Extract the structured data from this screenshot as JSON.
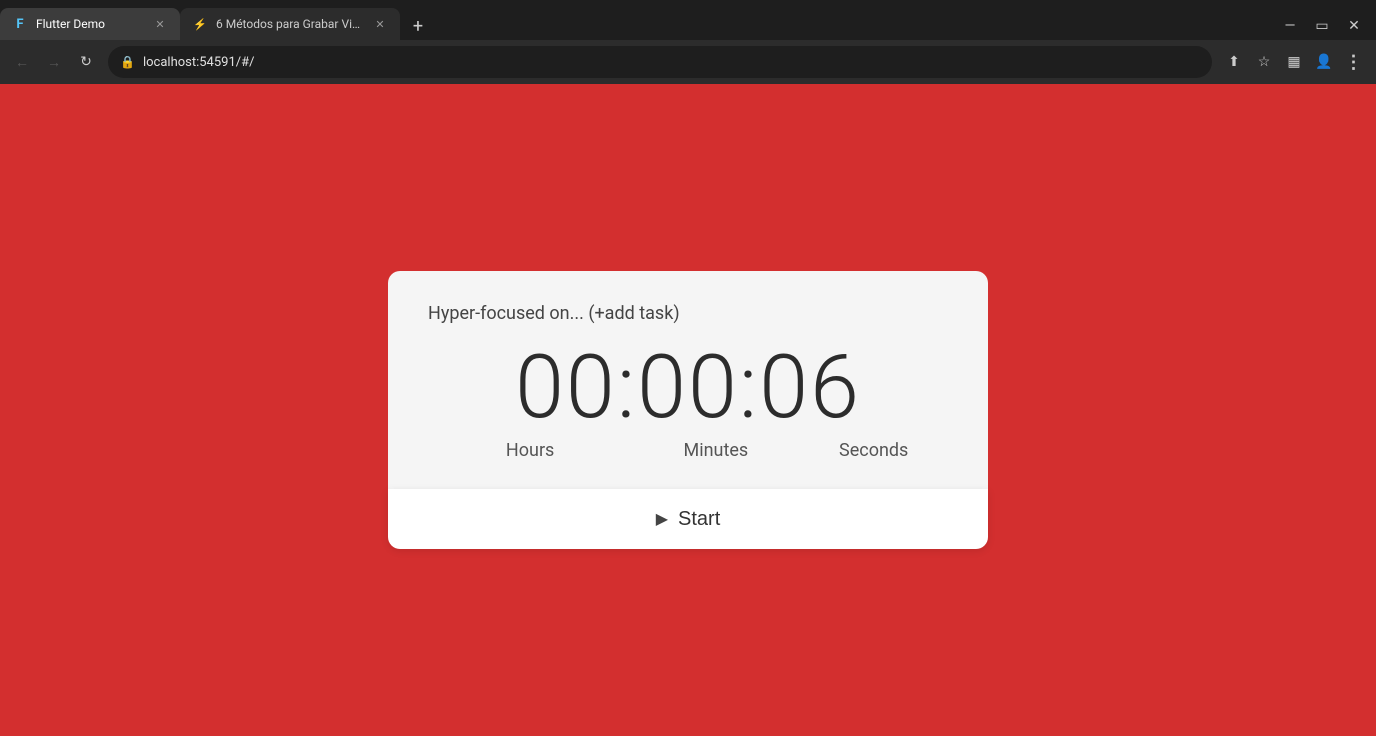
{
  "browser": {
    "tabs": [
      {
        "id": "tab-flutter",
        "favicon": "F",
        "favicon_color": "#54C5F8",
        "title": "Flutter Demo",
        "active": true,
        "closable": true
      },
      {
        "id": "tab-video",
        "favicon": "⚡",
        "favicon_color": "#4fc3f7",
        "title": "6 Métodos para Grabar Video W...",
        "active": false,
        "closable": true
      }
    ],
    "new_tab_label": "+",
    "window_controls": {
      "minimize_icon": "—",
      "maximize_icon": "▭",
      "close_icon": "✕"
    },
    "nav": {
      "back_icon": "←",
      "forward_icon": "→",
      "reload_icon": "↻"
    },
    "address": {
      "lock_icon": "🔒",
      "url": "localhost:54591/#/",
      "share_icon": "⬆",
      "bookmark_icon": "☆",
      "sidebar_icon": "▦",
      "account_icon": "👤",
      "menu_icon": "⋮"
    }
  },
  "app": {
    "background_color": "#d32f2f",
    "card": {
      "task_label": "Hyper-focused on... (+add task)",
      "timer": {
        "display": "00:00:06",
        "hours_label": "Hours",
        "minutes_label": "Minutes",
        "seconds_label": "Seconds"
      },
      "start_button_label": "Start",
      "play_icon": "▶"
    }
  }
}
